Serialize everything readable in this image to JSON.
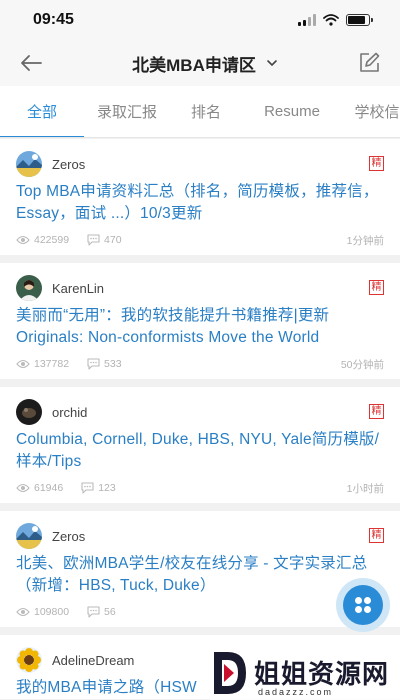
{
  "status": {
    "time": "09:45"
  },
  "nav": {
    "title": "北美MBA申请区"
  },
  "tabs": [
    {
      "label": "全部",
      "active": true
    },
    {
      "label": "录取汇报"
    },
    {
      "label": "排名"
    },
    {
      "label": "Resume"
    },
    {
      "label": "学校信"
    }
  ],
  "posts": [
    {
      "author": "Zeros",
      "badge": "精",
      "title": "Top MBA申请资料汇总（排名，简历模板，推荐信，Essay，面试 ...）10/3更新",
      "views": "422599",
      "comments": "470",
      "time": "1分钟前",
      "avatar_icon": "landscape-avatar"
    },
    {
      "author": "KarenLin",
      "badge": "精",
      "title": "美丽而“无用”：我的软技能提升书籍推荐|更新Originals: Non-conformists Move the World",
      "views": "137782",
      "comments": "533",
      "time": "50分钟前",
      "avatar_icon": "person-avatar"
    },
    {
      "author": "orchid",
      "badge": "精",
      "title": "Columbia, Cornell, Duke, HBS, NYU, Yale简历模版/样本/Tips",
      "views": "61946",
      "comments": "123",
      "time": "1小时前",
      "avatar_icon": "dark-avatar"
    },
    {
      "author": "Zeros",
      "badge": "精",
      "title": "北美、欧洲MBA学生/校友在线分享 - 文字实录汇总（新增：HBS, Tuck, Duke）",
      "views": "109800",
      "comments": "56",
      "time": "",
      "avatar_icon": "landscape-avatar"
    },
    {
      "author": "AdelineDream",
      "badge": "",
      "title": "我的MBA申请之路（HSW",
      "views": "",
      "comments": "",
      "time": "",
      "avatar_icon": "sunflower-avatar"
    }
  ],
  "watermark": {
    "text": "姐姐资源网",
    "url": "dadazzz.com"
  },
  "colors": {
    "accent": "#2a8bd6",
    "badge": "#dd3333"
  }
}
